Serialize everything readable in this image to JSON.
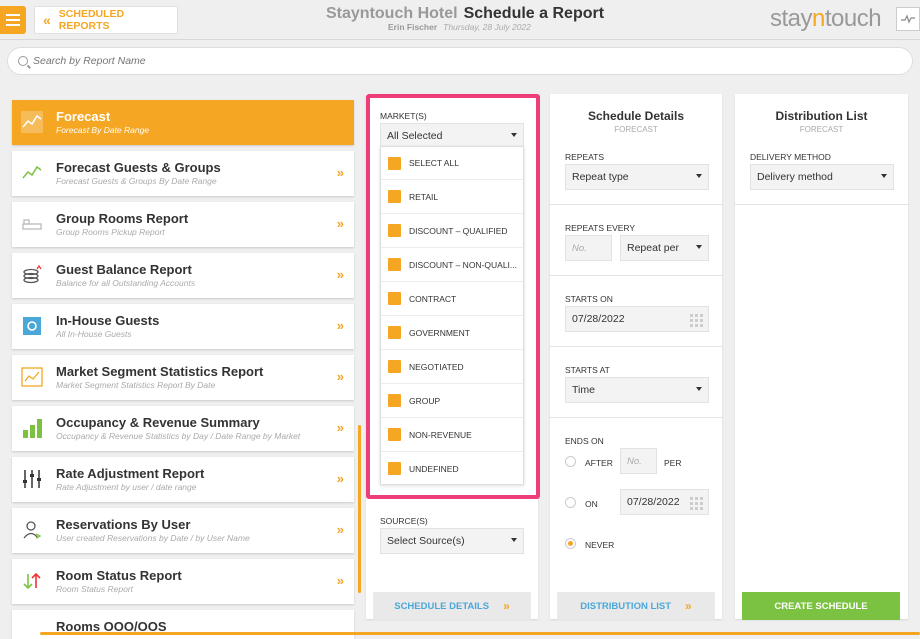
{
  "header": {
    "back_label": "SCHEDULED REPORTS",
    "hotel": "Stayntouch Hotel",
    "page_title": "Schedule a Report",
    "user": "Erin Fischer",
    "date": "Thursday, 28 July 2022",
    "logo_a": "stay",
    "logo_n": "n",
    "logo_b": "touch"
  },
  "search": {
    "placeholder": "Search by Report Name"
  },
  "reports": [
    {
      "name": "Forecast",
      "desc": "Forecast By Date Range",
      "icon": "forecast-icon",
      "active": true
    },
    {
      "name": "Forecast Guests & Groups",
      "desc": "Forecast Guests & Groups By Date Range",
      "icon": "forecast-guests-icon"
    },
    {
      "name": "Group Rooms Report",
      "desc": "Group Rooms Pickup Report",
      "icon": "bed-icon"
    },
    {
      "name": "Guest Balance Report",
      "desc": "Balance for all Outstanding Accounts",
      "icon": "coins-icon"
    },
    {
      "name": "In-House Guests",
      "desc": "All In-House Guests",
      "icon": "in-house-icon"
    },
    {
      "name": "Market Segment Statistics Report",
      "desc": "Market Segment Statistics Report By Date",
      "icon": "line-chart-icon"
    },
    {
      "name": "Occupancy & Revenue Summary",
      "desc": "Occupancy & Revenue Statistics by Day / Date Range by Market",
      "icon": "bar-chart-icon"
    },
    {
      "name": "Rate Adjustment Report",
      "desc": "Rate Adjustment by user / date range",
      "icon": "sliders-icon"
    },
    {
      "name": "Reservations By User",
      "desc": "User created Reservations by Date / by User Name",
      "icon": "user-icon"
    },
    {
      "name": "Room Status Report",
      "desc": "Room Status Report",
      "icon": "status-arrows-icon"
    },
    {
      "name": "Rooms OOO/OOS",
      "desc": "",
      "icon": ""
    }
  ],
  "market": {
    "label": "MARKET(S)",
    "selected": "All Selected",
    "options": [
      "SELECT ALL",
      "RETAIL",
      "DISCOUNT – QUALIFIED",
      "DISCOUNT – NON-QUALI...",
      "CONTRACT",
      "GOVERNMENT",
      "NEGOTIATED",
      "GROUP",
      "NON-REVENUE",
      "UNDEFINED"
    ],
    "source_label": "SOURCE(S)",
    "source_selected": "Select Source(s)",
    "footer_button": "SCHEDULE DETAILS"
  },
  "schedule": {
    "title": "Schedule Details",
    "subtitle": "FORECAST",
    "repeats_label": "REPEATS",
    "repeats_value": "Repeat type",
    "repeats_every_label": "REPEATS EVERY",
    "repeats_every_placeholder": "No.",
    "repeats_per": "Repeat per",
    "starts_on_label": "STARTS ON",
    "starts_on_value": "07/28/2022",
    "starts_at_label": "STARTS AT",
    "starts_at_value": "Time",
    "ends_on_label": "ENDS ON",
    "after_label": "AFTER",
    "after_placeholder": "No.",
    "per_label": "PER",
    "on_label": "ON",
    "on_value": "07/28/2022",
    "never_label": "NEVER",
    "selected_end": "never",
    "footer_button": "DISTRIBUTION LIST"
  },
  "distribution": {
    "title": "Distribution List",
    "subtitle": "FORECAST",
    "delivery_label": "DELIVERY METHOD",
    "delivery_value": "Delivery method",
    "footer_button": "CREATE SCHEDULE"
  },
  "colors": {
    "accent": "#f5a623",
    "highlight": "#ee3e7a",
    "link": "#4aa8d8",
    "create": "#7cc242"
  }
}
